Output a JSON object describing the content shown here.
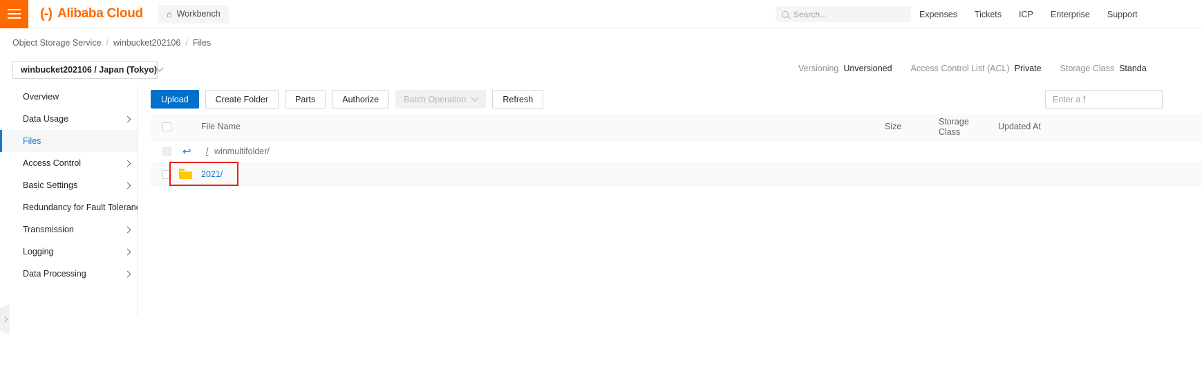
{
  "topbar": {
    "menu_icon": "hamburger-icon",
    "brand_mark": "(-)",
    "brand_name": "Alibaba Cloud",
    "workbench_icon": "home-icon",
    "workbench_label": "Workbench",
    "search_icon": "search-icon",
    "search_placeholder": "Search...",
    "nav": [
      {
        "label": "Expenses"
      },
      {
        "label": "Tickets"
      },
      {
        "label": "ICP"
      },
      {
        "label": "Enterprise"
      },
      {
        "label": "Support"
      }
    ]
  },
  "breadcrumb": {
    "items": [
      {
        "label": "Object Storage Service"
      },
      {
        "label": "winbucket202106"
      },
      {
        "label": "Files"
      }
    ],
    "separator": "/"
  },
  "bucket_selector": {
    "label": "winbucket202106 / Japan (Tokyo)",
    "chevron_icon": "chevron-down-icon"
  },
  "bucket_meta": {
    "versioning_key": "Versioning",
    "versioning_value": "Unversioned",
    "acl_key": "Access Control List (ACL)",
    "acl_value": "Private",
    "storage_class_key": "Storage Class",
    "storage_class_value": "Standa"
  },
  "sidebar": {
    "items": [
      {
        "label": "Overview",
        "expandable": false,
        "active": false
      },
      {
        "label": "Data Usage",
        "expandable": true,
        "active": false
      },
      {
        "label": "Files",
        "expandable": false,
        "active": true
      },
      {
        "label": "Access Control",
        "expandable": true,
        "active": false
      },
      {
        "label": "Basic Settings",
        "expandable": true,
        "active": false
      },
      {
        "label": "Redundancy for Fault Tolerance",
        "expandable": true,
        "active": false
      },
      {
        "label": "Transmission",
        "expandable": true,
        "active": false
      },
      {
        "label": "Logging",
        "expandable": true,
        "active": false
      },
      {
        "label": "Data Processing",
        "expandable": true,
        "active": false
      }
    ],
    "collapse_icon": "chevron-right-icon"
  },
  "toolbar": {
    "upload_label": "Upload",
    "create_folder_label": "Create Folder",
    "parts_label": "Parts",
    "authorize_label": "Authorize",
    "batch_operation_label": "Batch Operation",
    "batch_operation_disabled": true,
    "refresh_label": "Refresh",
    "filter_placeholder": "Enter a f"
  },
  "table": {
    "columns": {
      "file_name": "File Name",
      "size": "Size",
      "storage_class": "Storage Class",
      "updated_at": "Updated At"
    },
    "parent_row": {
      "back_icon": "back-arrow-icon",
      "slash_icon": "/",
      "name": "winmultifolder/"
    },
    "rows": [
      {
        "folder_icon": "folder-icon",
        "name": "2021/",
        "size": "",
        "storage_class": "",
        "updated_at": "",
        "highlighted": true
      }
    ]
  },
  "annotation": {
    "color": "#ee1b11",
    "target": "2021/"
  }
}
